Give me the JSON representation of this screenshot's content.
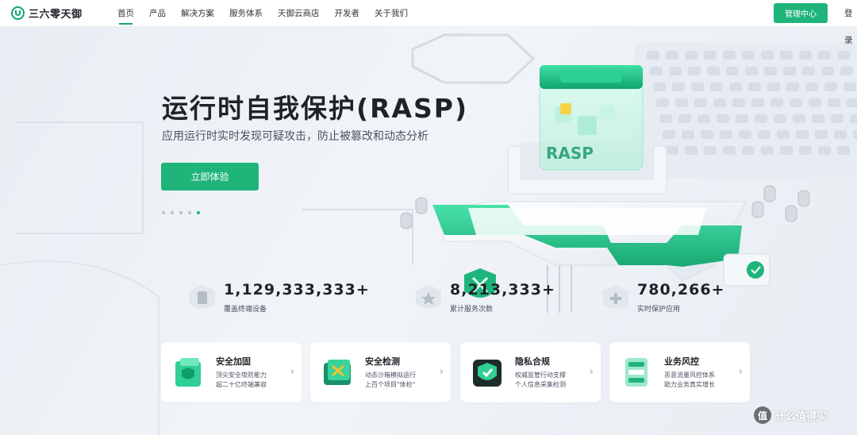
{
  "nav": {
    "logo_text": "三六零天御",
    "menu": [
      {
        "label": "首页",
        "active": true
      },
      {
        "label": "产品",
        "active": false
      },
      {
        "label": "解决方案",
        "active": false
      },
      {
        "label": "服务体系",
        "active": false
      },
      {
        "label": "天御云商店",
        "active": false
      },
      {
        "label": "开发者",
        "active": false
      },
      {
        "label": "关于我们",
        "active": false
      }
    ],
    "management_button": "管理中心",
    "login": "登录"
  },
  "hero": {
    "title": "运行时自我保护(RASP)",
    "subtitle": "应用运行时实时发现可疑攻击，防止被篡改和动态分析",
    "cta": "立即体验",
    "carousel": {
      "total": 5,
      "current": 5
    },
    "illustration_text": "RASP"
  },
  "stats": [
    {
      "value": "1,129,333,333+",
      "label": "覆盖终端设备",
      "icon": "device-cube-icon"
    },
    {
      "value": "8,213,333+",
      "label": "累计服务次数",
      "icon": "star-shield-icon"
    },
    {
      "value": "780,266+",
      "label": "实时保护应用",
      "icon": "plus-shield-icon"
    }
  ],
  "cards": [
    {
      "title": "安全加固",
      "desc1": "顶尖安全攻防能力",
      "desc2": "超二十亿终端兼容",
      "icon": "shield-cube-icon"
    },
    {
      "title": "安全检测",
      "desc1": "动态沙箱模拟运行",
      "desc2": "上百个项目\"体检\"",
      "icon": "detection-box-icon"
    },
    {
      "title": "隐私合规",
      "desc1": "权威监管行动支撑",
      "desc2": "个人信息采集检测",
      "icon": "privacy-shield-icon"
    },
    {
      "title": "业务风控",
      "desc1": "恶意流量风控体系",
      "desc2": "助力业务真实增长",
      "icon": "risk-server-icon"
    }
  ],
  "watermark": {
    "symbol": "值",
    "text": "什么值得买"
  },
  "colors": {
    "brand": "#1fb57a",
    "text": "#1f2329",
    "muted": "#4a5260"
  }
}
